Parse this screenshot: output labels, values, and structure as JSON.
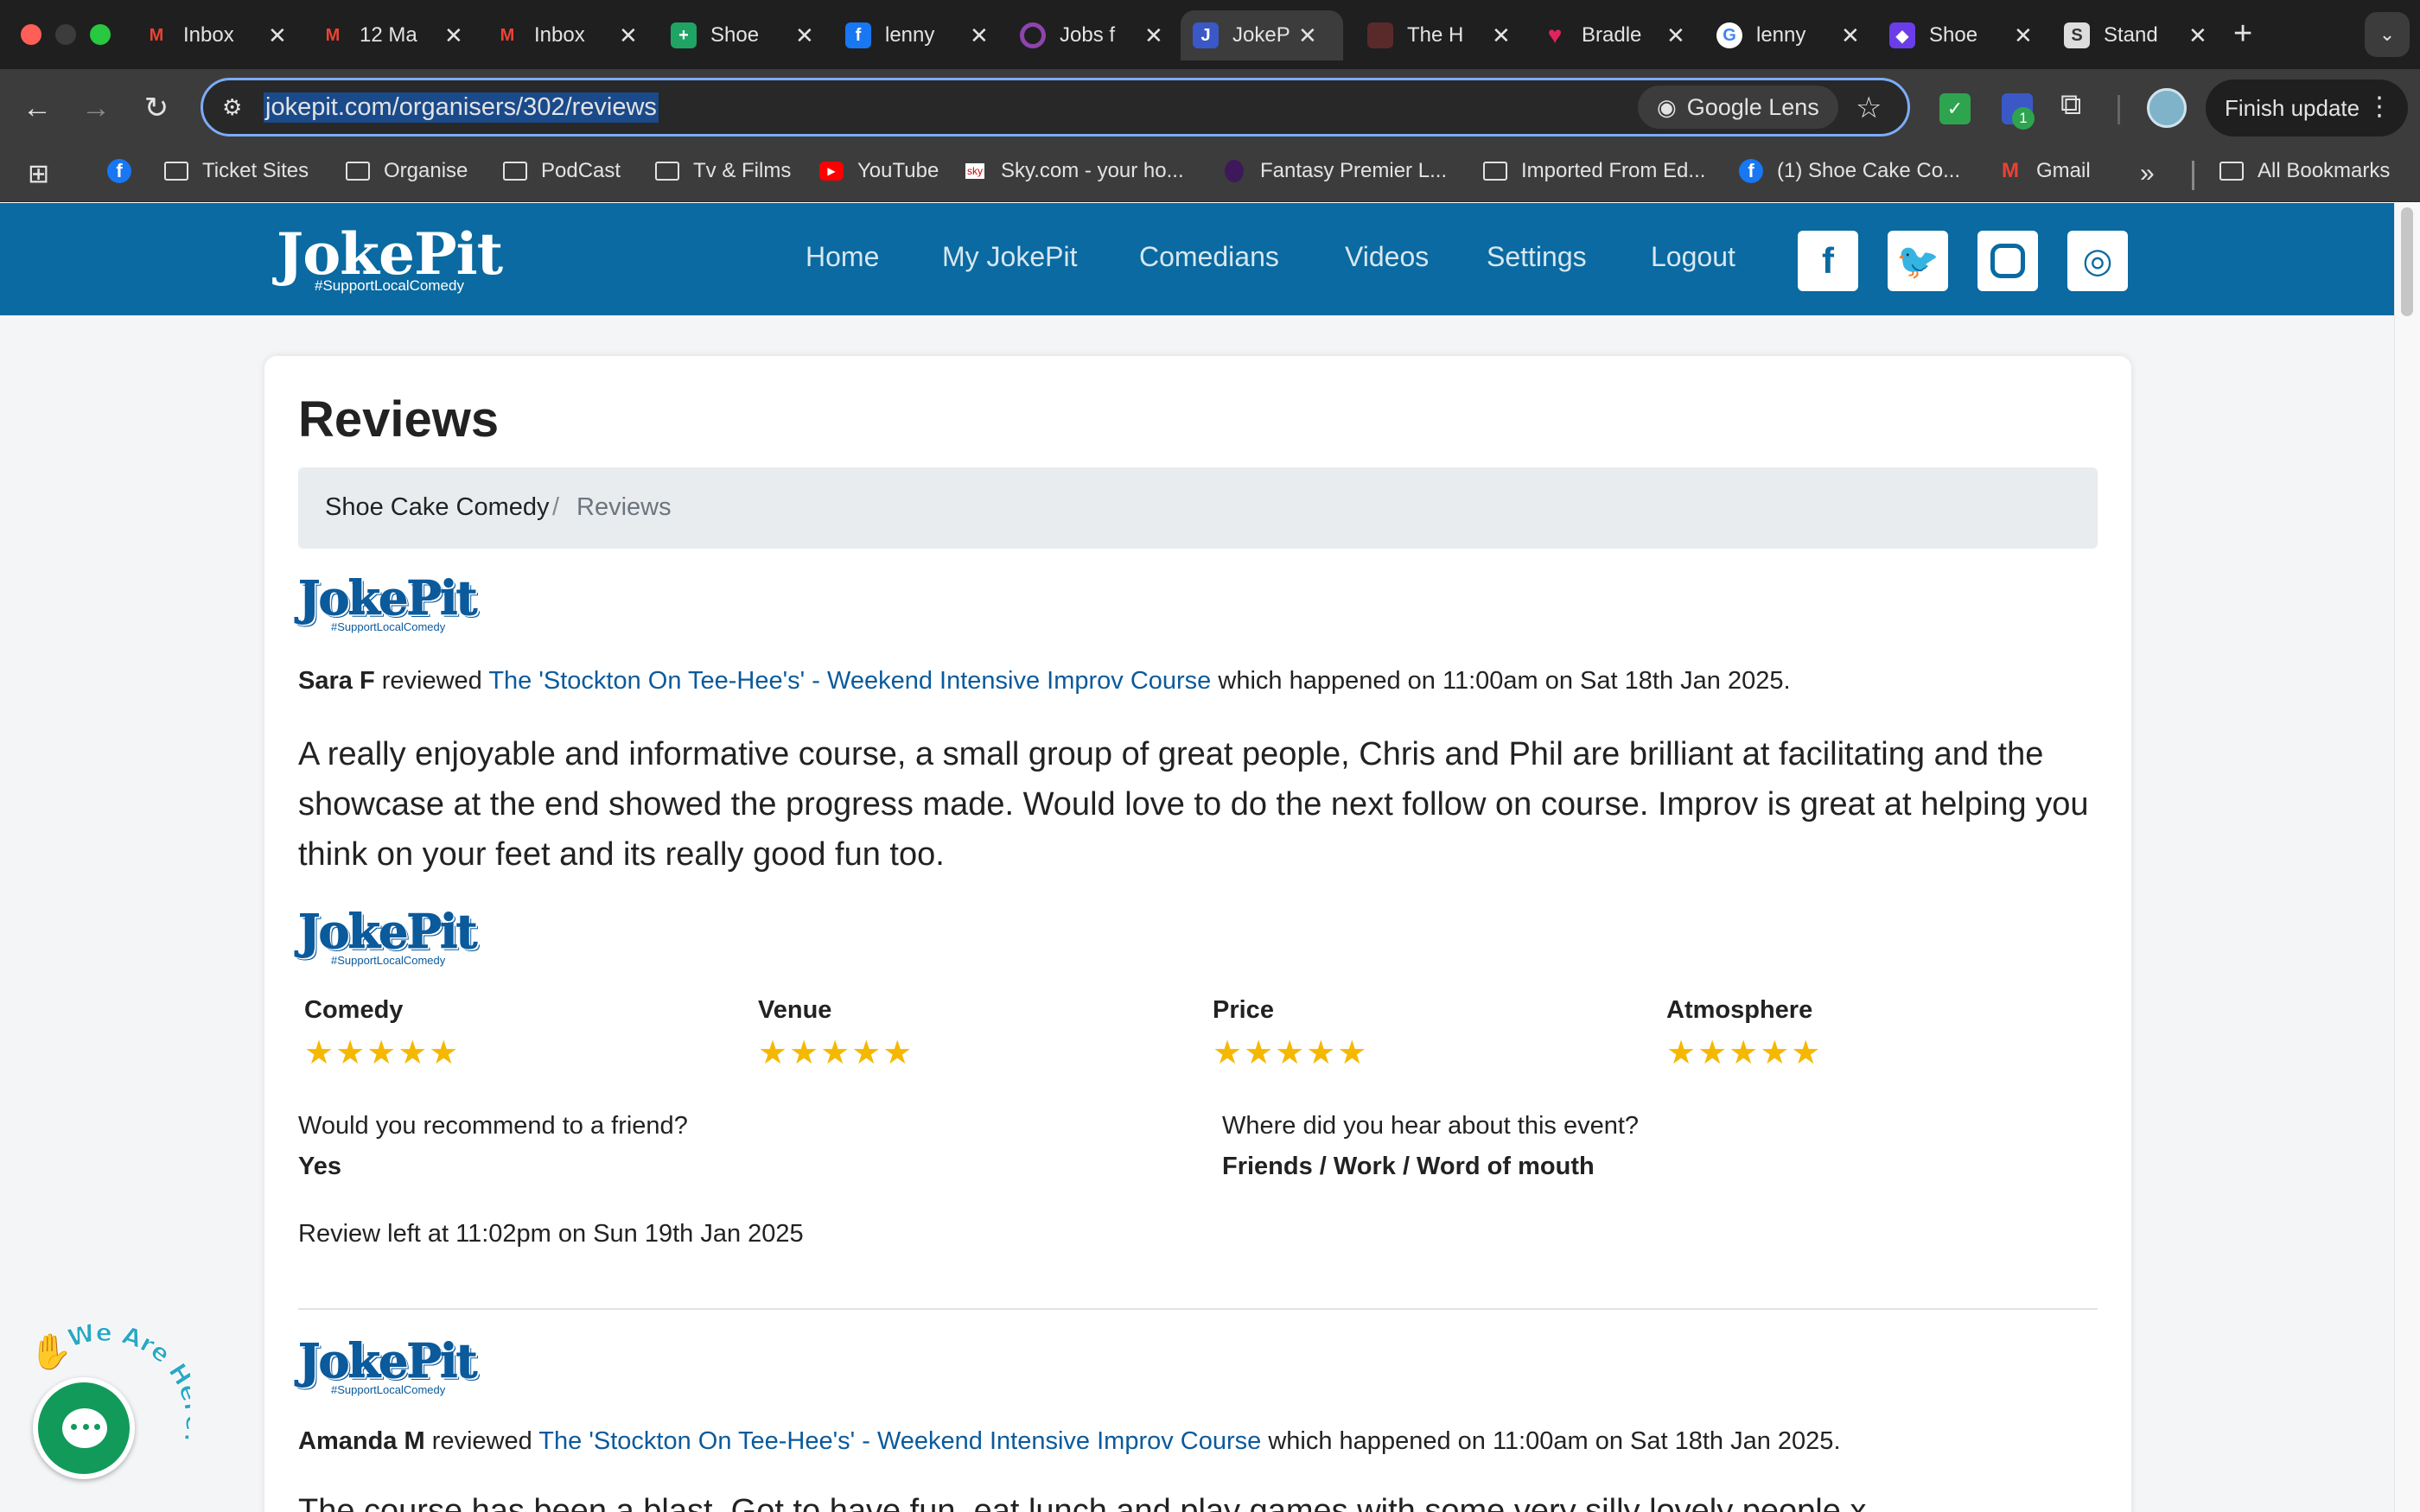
{
  "tabs": [
    {
      "label": "Inbox",
      "icon": "gmail-icon"
    },
    {
      "label": "12 Ma",
      "icon": "gmail-icon"
    },
    {
      "label": "Inbox",
      "icon": "gmail-icon"
    },
    {
      "label": "Shoe",
      "icon": "sheets-icon"
    },
    {
      "label": "lenny",
      "icon": "facebook-icon"
    },
    {
      "label": "Jobs f",
      "icon": "ring-icon"
    },
    {
      "label": "JokeP",
      "icon": "jokepit-icon",
      "active": true
    },
    {
      "label": "The H",
      "icon": "photo-icon"
    },
    {
      "label": "Bradle",
      "icon": "heart-icon"
    },
    {
      "label": "lenny",
      "icon": "google-icon"
    },
    {
      "label": "Shoe",
      "icon": "app-icon"
    },
    {
      "label": "Stand",
      "icon": "standup-icon"
    }
  ],
  "toolbar": {
    "url": "jokepit.com/organisers/302/reviews",
    "lens_label": "Google Lens",
    "ext_badge": "1",
    "finish_update": "Finish update"
  },
  "bookmarks": [
    {
      "label": "Ticket Sites",
      "icon": "folder-icon"
    },
    {
      "label": "Organise",
      "icon": "folder-icon"
    },
    {
      "label": "PodCast",
      "icon": "folder-icon"
    },
    {
      "label": "Tv & Films",
      "icon": "folder-icon"
    },
    {
      "label": "YouTube",
      "icon": "youtube-icon"
    },
    {
      "label": "Sky.com - your ho...",
      "icon": "sky-icon"
    },
    {
      "label": "Fantasy Premier L...",
      "icon": "lion-icon"
    },
    {
      "label": "Imported From Ed...",
      "icon": "folder-icon"
    },
    {
      "label": "(1) Shoe Cake Co...",
      "icon": "facebook-icon"
    },
    {
      "label": "Gmail",
      "icon": "gmail-icon"
    }
  ],
  "bookmarks_all": "All Bookmarks",
  "site": {
    "logo": "JokePit",
    "logo_sub": "#SupportLocalComedy",
    "nav": [
      "Home",
      "My JokePit",
      "Comedians",
      "Videos",
      "Settings",
      "Logout"
    ],
    "social": [
      "facebook-icon",
      "twitter-icon",
      "instagram-icon",
      "podcast-icon"
    ]
  },
  "page": {
    "title": "Reviews",
    "breadcrumb": [
      "Shoe Cake Comedy",
      "Reviews"
    ]
  },
  "review1": {
    "reviewer": "Sara F",
    "reviewed": " reviewed ",
    "event": "The 'Stockton On Tee-Hee's' - Weekend Intensive Improv Course",
    "when": " which happened on 11:00am on Sat 18th Jan 2025.",
    "body": "A really enjoyable and informative course, a small group of great people, Chris and Phil are brilliant at facilitating and the showcase at the end showed the progress made. Would love to do the next follow on course. Improv is great at helping you think on your feet and its really good fun too.",
    "ratings": [
      {
        "category": "Comedy",
        "stars": 5
      },
      {
        "category": "Venue",
        "stars": 5
      },
      {
        "category": "Price",
        "stars": 5
      },
      {
        "category": "Atmosphere",
        "stars": 5
      }
    ],
    "stars_text": "★★★★★",
    "recommend_q": "Would you recommend to a friend?",
    "recommend_a": "Yes",
    "hear_q": "Where did you hear about this event?",
    "hear_a": "Friends / Work / Word of mouth",
    "left_at": "Review left at 11:02pm on Sun 19th Jan 2025"
  },
  "review2": {
    "reviewer": "Amanda M",
    "reviewed": " reviewed ",
    "event": "The 'Stockton On Tee-Hee's' - Weekend Intensive Improv Course",
    "when": " which happened on 11:00am on Sat 18th Jan 2025.",
    "body": "The course has been a blast. Got to have fun, eat lunch and play games with some very silly lovely people x"
  },
  "chat": {
    "badge": "We Are Here!"
  },
  "colors": {
    "brand_blue": "#0a6aa1",
    "star_gold": "#f5b800",
    "link_blue": "#0a5a9c",
    "chat_green": "#119a5a"
  }
}
